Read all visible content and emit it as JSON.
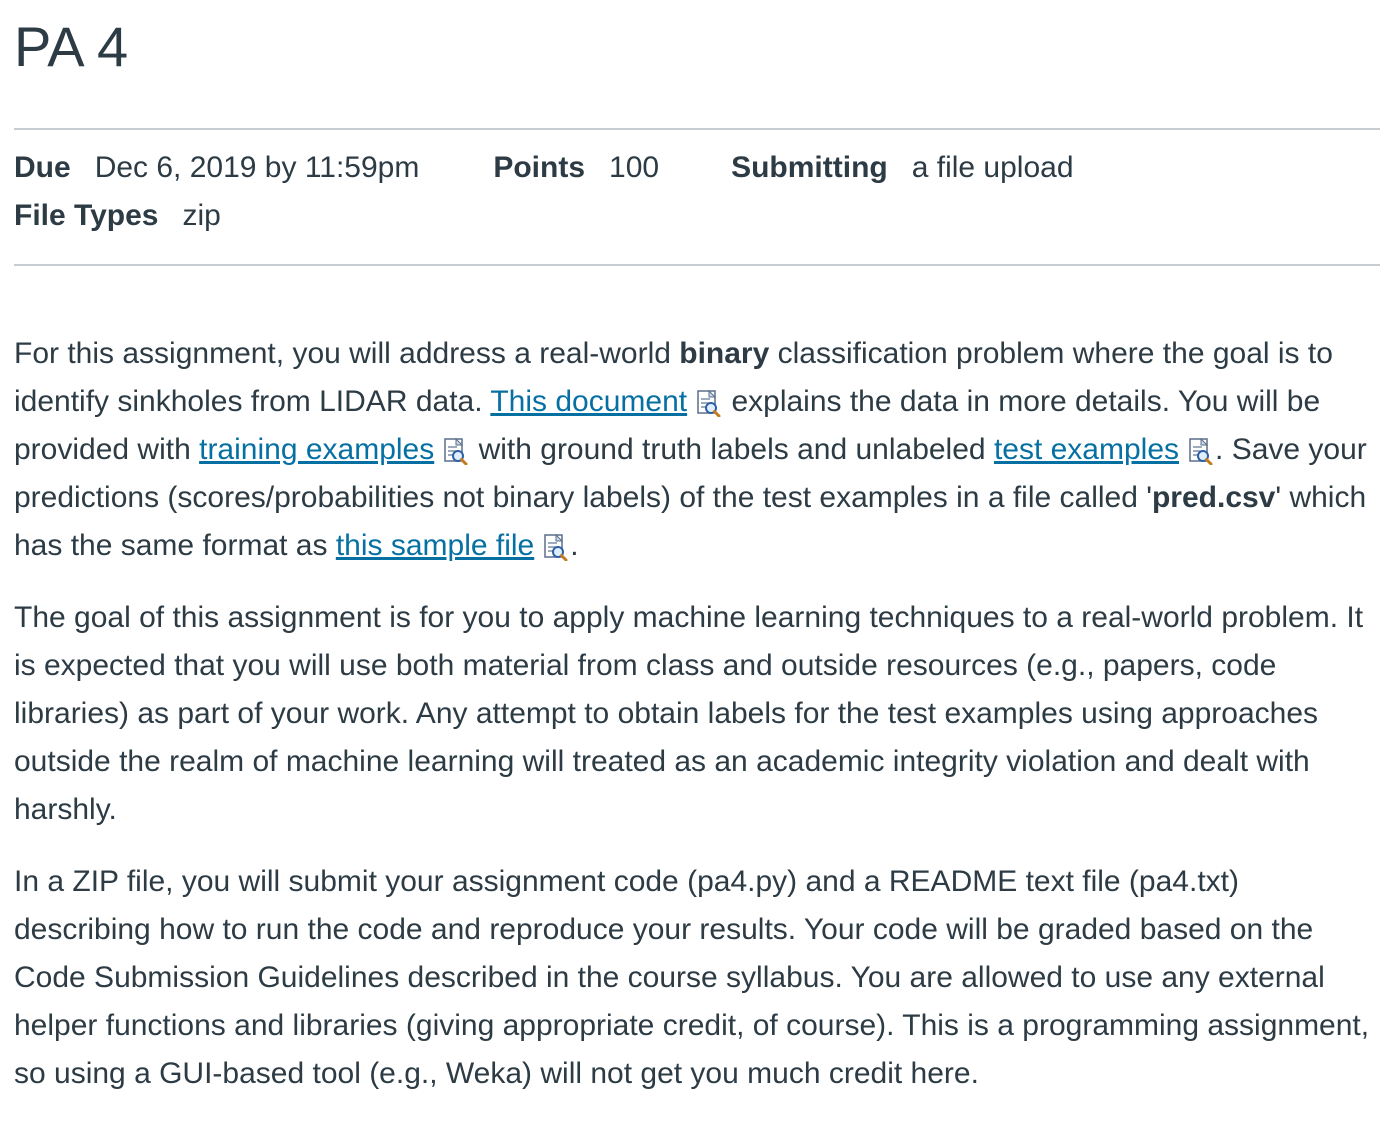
{
  "assignment": {
    "title": "PA 4"
  },
  "details": {
    "due_label": "Due",
    "due_value": "Dec 6, 2019 by 11:59pm",
    "points_label": "Points",
    "points_value": "100",
    "submitting_label": "Submitting",
    "submitting_value": "a file upload",
    "file_types_label": "File Types",
    "file_types_value": "zip"
  },
  "description": {
    "p1": {
      "t1": "For this assignment, you will address a real-world ",
      "bold1": "binary",
      "t2": " classification problem where the goal is to identify sinkholes from LIDAR data. ",
      "link1": "This document",
      "t3": " explains the data in more details. You will be provided with ",
      "link2": "training examples",
      "t4": " with ground truth labels and unlabeled ",
      "link3": "test examples",
      "t5": ". Save your predictions (scores/probabilities not binary labels) of the test examples in a file called '",
      "bold2": "pred.csv",
      "t6": "' which has the same format as ",
      "link4": "this sample file",
      "t7": "."
    },
    "p2": "The goal of this assignment is for you to apply machine learning techniques to a real-world problem. It is expected that you will use both material from class and outside resources (e.g., papers, code libraries) as part of your work. Any attempt to obtain labels for the test examples using approaches outside the realm of machine learning will treated as an academic integrity violation and dealt with harshly.",
    "p3": "In a ZIP file, you will submit your assignment code (pa4.py) and a README text file (pa4.txt) describing how to run the code and reproduce your results. Your code will be graded based on the Code Submission Guidelines described in the course syllabus. You are allowed to use any external helper functions and libraries (giving appropriate credit, of course). This is a programming assignment, so using a GUI-based tool (e.g., Weka) will not get you much credit here."
  },
  "icons": {
    "file_preview": "document-preview-icon"
  },
  "colors": {
    "link": "#0770a3",
    "text": "#2d3b45",
    "divider": "#c7cdd1"
  }
}
